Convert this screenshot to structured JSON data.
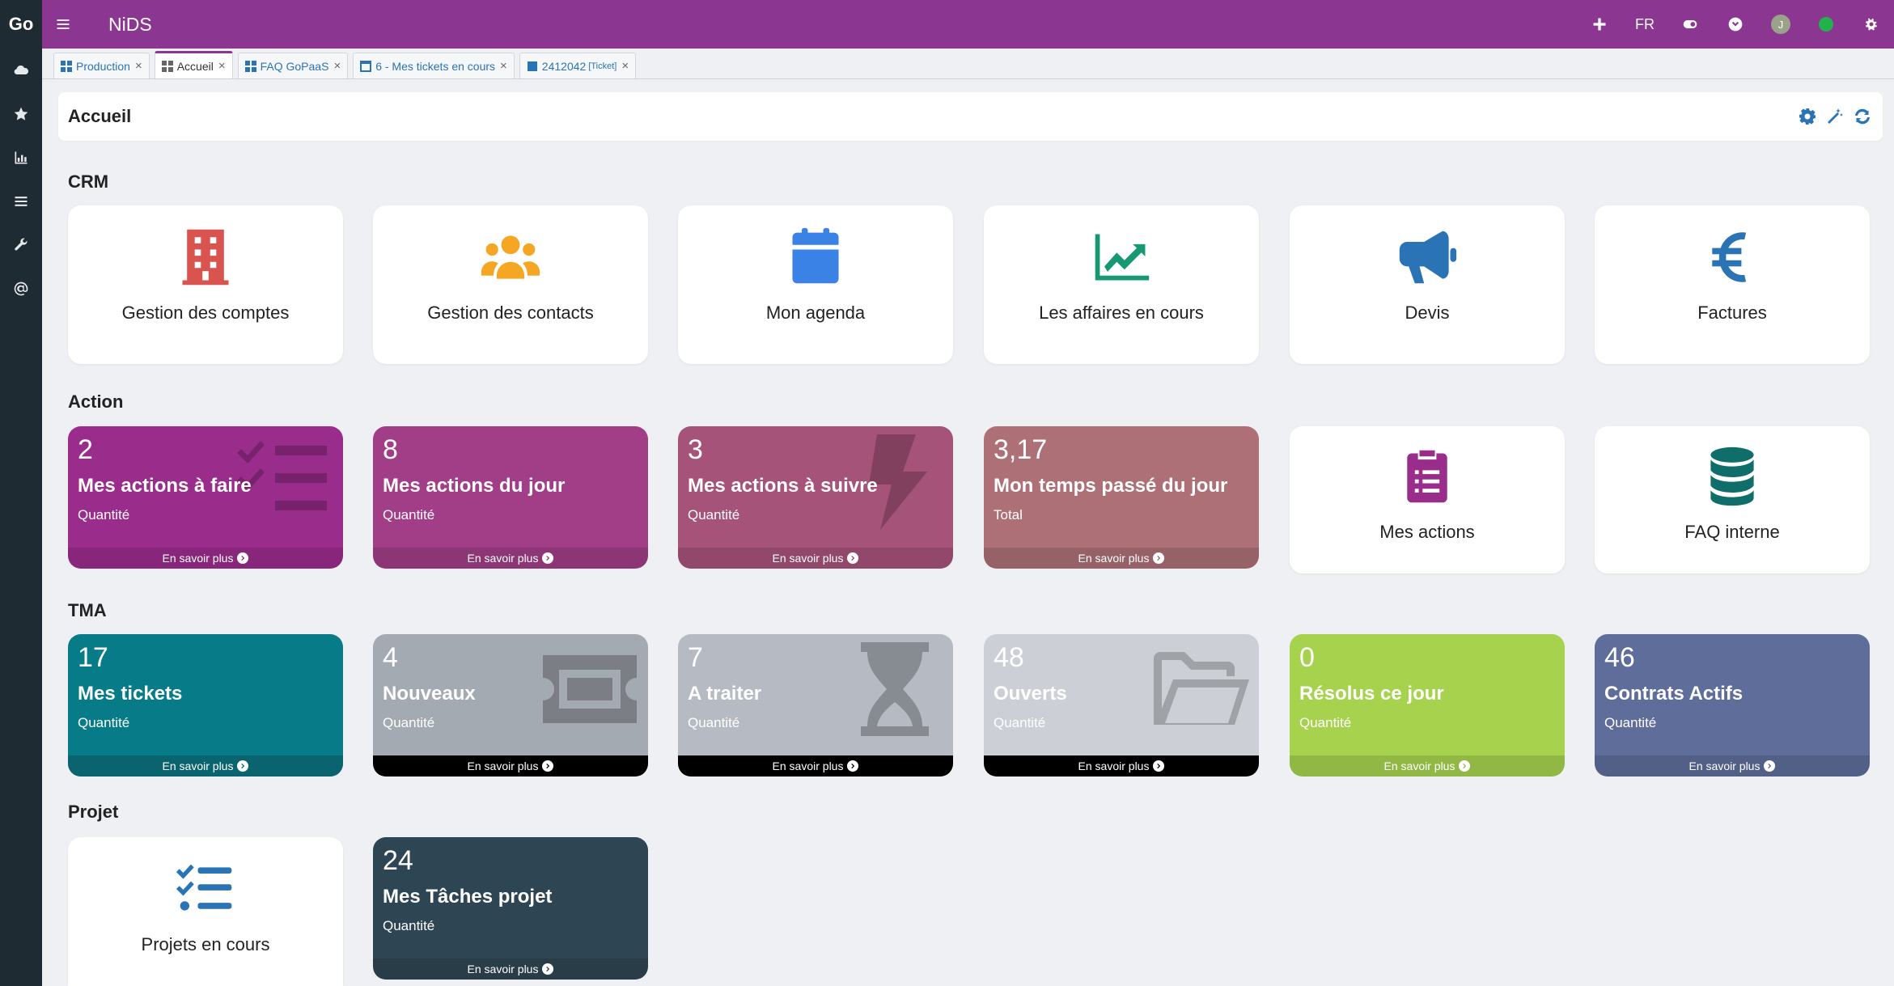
{
  "app": {
    "logo": "Go",
    "title": "NiDS"
  },
  "topbar": {
    "lang": "FR",
    "avatar_initial": "J"
  },
  "tabs": [
    {
      "label": "Production",
      "icon": "grid-icon"
    },
    {
      "label": "Accueil",
      "icon": "grid-icon",
      "active": true
    },
    {
      "label": "FAQ GoPaaS",
      "icon": "grid-icon"
    },
    {
      "label": "6 - Mes tickets en cours",
      "icon": "window-icon"
    },
    {
      "label": "2412042",
      "small": "[Ticket]",
      "icon": "ticket-icon"
    }
  ],
  "header": {
    "title": "Accueil"
  },
  "sections": {
    "crm": "CRM",
    "action": "Action",
    "tma": "TMA",
    "projet": "Projet"
  },
  "more_label": "En savoir plus",
  "crm": [
    {
      "label": "Gestion des comptes",
      "icon": "building-icon",
      "color": "#d9534f"
    },
    {
      "label": "Gestion des contacts",
      "icon": "users-icon",
      "color": "#f5a623"
    },
    {
      "label": "Mon agenda",
      "icon": "calendar-icon",
      "color": "#3b82e6"
    },
    {
      "label": "Les affaires en cours",
      "icon": "chart-line-icon",
      "color": "#169873"
    },
    {
      "label": "Devis",
      "icon": "megaphone-icon",
      "color": "#2a73b5"
    },
    {
      "label": "Factures",
      "icon": "euro-icon",
      "color": "#2a73b5"
    }
  ],
  "action": [
    {
      "value": "2",
      "label": "Mes actions à faire",
      "sub": "Quantité",
      "color": "#9a2c8c",
      "icon": "tasks-icon"
    },
    {
      "value": "8",
      "label": "Mes actions du jour",
      "sub": "Quantité",
      "color": "#a13e87",
      "icon": ""
    },
    {
      "value": "3",
      "label": "Mes actions à suivre",
      "sub": "Quantité",
      "color": "#a65379",
      "icon": "bolt-icon"
    },
    {
      "value": "3,17",
      "label": "Mon temps passé du jour",
      "sub": "Total",
      "color": "#ac7076",
      "icon": ""
    }
  ],
  "action_links": [
    {
      "label": "Mes actions",
      "icon": "clipboard-list-icon",
      "color": "#9a2c8c"
    },
    {
      "label": "FAQ interne",
      "icon": "database-icon",
      "color": "#0f6e6a"
    }
  ],
  "tma": [
    {
      "value": "17",
      "label": "Mes tickets",
      "sub": "Quantité",
      "color": "#077b88",
      "icon": "",
      "bar": "teal"
    },
    {
      "value": "4",
      "label": "Nouveaux",
      "sub": "Quantité",
      "color": "#a4aab2",
      "icon": "ticket-icon",
      "bar": "dark"
    },
    {
      "value": "7",
      "label": "A traiter",
      "sub": "Quantité",
      "color": "#b5bac3",
      "icon": "hourglass-icon",
      "bar": "dark"
    },
    {
      "value": "48",
      "label": "Ouverts",
      "sub": "Quantité",
      "color": "#ccd0d6",
      "icon": "folder-open-icon",
      "bar": "dark"
    },
    {
      "value": "0",
      "label": "Résolus ce jour",
      "sub": "Quantité",
      "color": "#a6d24e",
      "icon": "",
      "bar": ""
    },
    {
      "value": "46",
      "label": "Contrats Actifs",
      "sub": "Quantité",
      "color": "#5e6d99",
      "icon": "",
      "bar": ""
    }
  ],
  "projet": {
    "link": {
      "label": "Projets en cours",
      "icon": "list-check-icon",
      "color": "#2a73b5"
    },
    "stat": {
      "value": "24",
      "label": "Mes Tâches projet",
      "sub": "Quantité",
      "color": "#2e4653"
    }
  }
}
